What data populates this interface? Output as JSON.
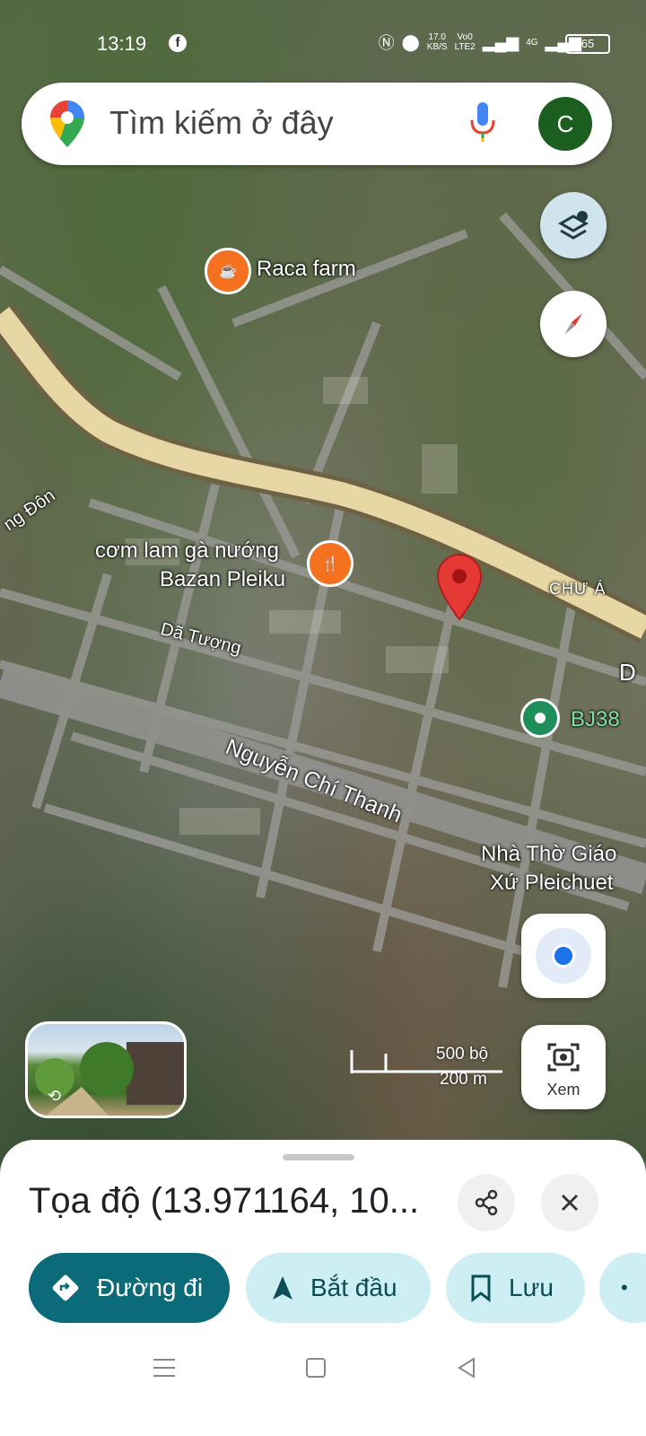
{
  "status_bar": {
    "time": "13:19",
    "speed_value": "17.0",
    "speed_unit": "KB/S",
    "volte_top": "Vo0",
    "volte_bottom": "LTE2",
    "network": "4G",
    "battery": "65"
  },
  "search": {
    "placeholder": "Tìm kiếm ở đây",
    "avatar_letter": "C"
  },
  "map": {
    "labels": {
      "raca_farm": "Raca farm",
      "com_lam_line1": "cơm lam gà nướng",
      "com_lam_line2": "Bazan Pleiku",
      "chu_a": "CHƯ Á",
      "da_tuong": "Dã Tượng",
      "nguyen_chi_thanh": "Nguyễn Chí Thanh",
      "bj38": "BJ38",
      "nha_tho_line1": "Nhà Thờ Giáo",
      "nha_tho_line2": "Xứ Pleichuet",
      "dong_don": "ng Đôn",
      "edge_d": "D"
    },
    "scale": {
      "imperial": "500 bộ",
      "metric": "200 m"
    },
    "view_label": "Xem"
  },
  "sheet": {
    "title": "Tọa độ (13.971164, 10...",
    "buttons": {
      "directions": "Đường đi",
      "start": "Bắt đầu",
      "save": "Lưu"
    }
  },
  "colors": {
    "primary": "#0b6b78",
    "secondary": "#cdeef3",
    "marker": "#e53935",
    "poi_orange": "#f4711f",
    "poi_green": "#1e8e5a"
  }
}
